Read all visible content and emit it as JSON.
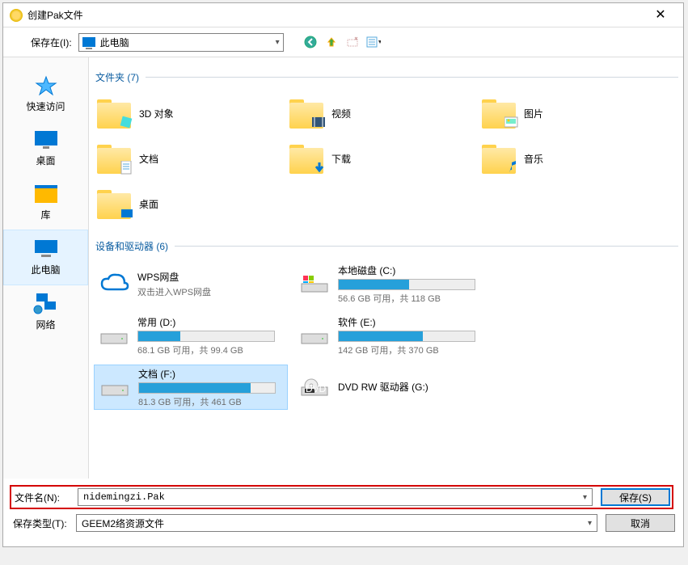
{
  "title": "创建Pak文件",
  "toolbar": {
    "saveInLabel": "保存在(I):",
    "location": "此电脑"
  },
  "sidebar": {
    "items": [
      {
        "label": "快速访问"
      },
      {
        "label": "桌面"
      },
      {
        "label": "库"
      },
      {
        "label": "此电脑"
      },
      {
        "label": "网络"
      }
    ]
  },
  "groups": {
    "folders": {
      "header": "文件夹 (7)"
    },
    "drives": {
      "header": "设备和驱动器 (6)"
    }
  },
  "folders": [
    {
      "label": "3D 对象"
    },
    {
      "label": "视频"
    },
    {
      "label": "图片"
    },
    {
      "label": "文档"
    },
    {
      "label": "下载"
    },
    {
      "label": "音乐"
    },
    {
      "label": "桌面"
    }
  ],
  "drives": {
    "wps": {
      "name": "WPS网盘",
      "sub": "双击进入WPS网盘"
    },
    "c": {
      "name": "本地磁盘 (C:)",
      "text": "56.6 GB 可用，共 118 GB",
      "pct": 52
    },
    "d": {
      "name": "常用 (D:)",
      "text": "68.1 GB 可用，共 99.4 GB",
      "pct": 31
    },
    "e": {
      "name": "软件 (E:)",
      "text": "142 GB 可用，共 370 GB",
      "pct": 62
    },
    "f": {
      "name": "文档 (F:)",
      "text": "81.3 GB 可用，共 461 GB",
      "pct": 82
    },
    "g": {
      "name": "DVD RW 驱动器 (G:)"
    }
  },
  "footer": {
    "filenameLabel": "文件名(N):",
    "filenameValue": "nidemingzi.Pak",
    "filetypeLabel": "保存类型(T):",
    "filetypeValue": "GEEM2络资源文件",
    "saveBtn": "保存(S)",
    "cancelBtn": "取消"
  }
}
